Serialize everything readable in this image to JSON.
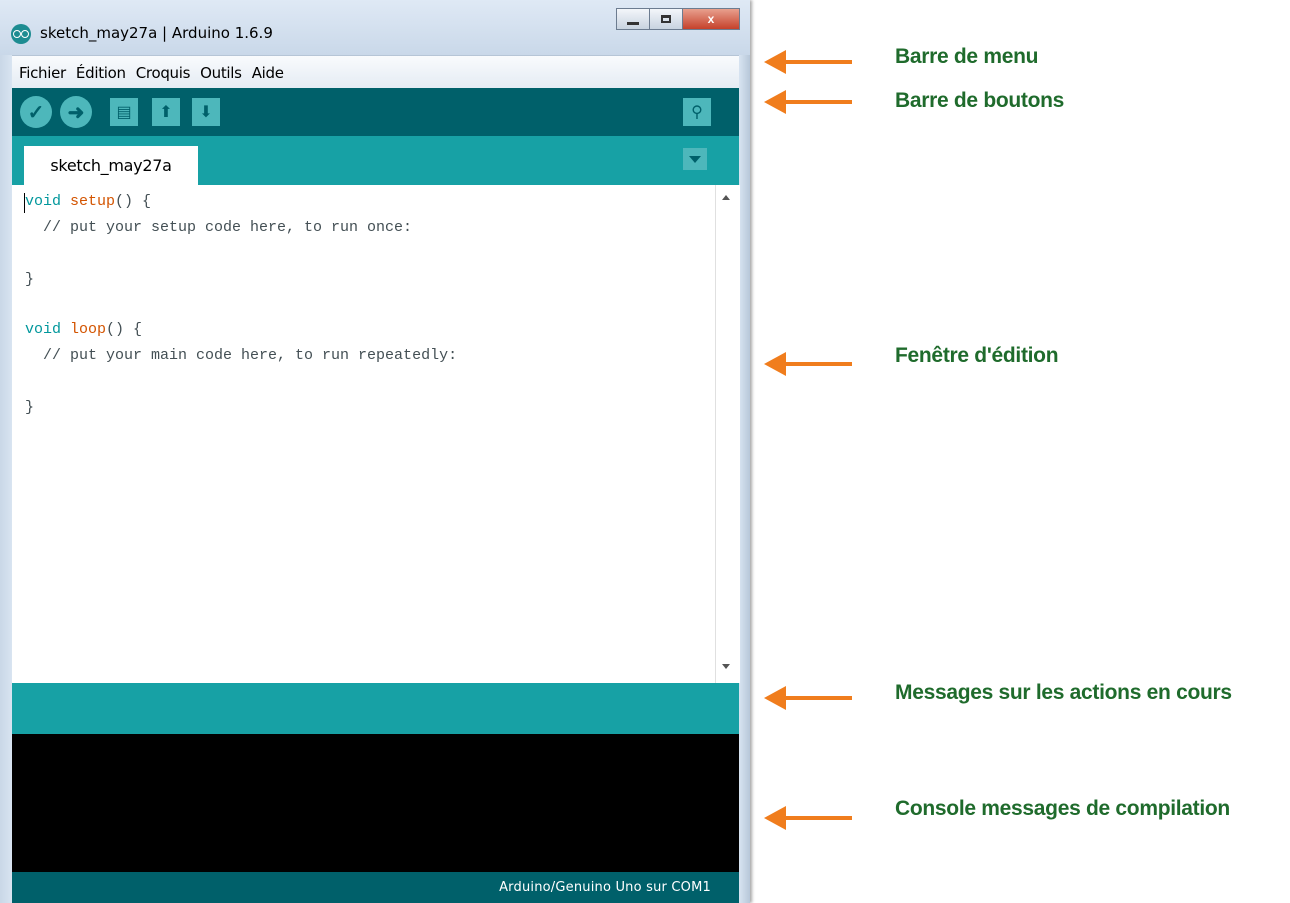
{
  "window": {
    "title": "sketch_may27a | Arduino 1.6.9",
    "close_glyph": "x"
  },
  "menu": {
    "items": [
      "Fichier",
      "Édition",
      "Croquis",
      "Outils",
      "Aide"
    ]
  },
  "toolbar": {
    "verify_glyph": "✓",
    "upload_glyph": "➜",
    "new_glyph": "▤",
    "open_glyph": "⬆",
    "save_glyph": "⬇",
    "serial_monitor_glyph": "⚲"
  },
  "tab": {
    "label": "sketch_may27a"
  },
  "editor": {
    "lines": [
      {
        "kw": "void",
        "fn": "setup",
        "rest": "() {"
      },
      {
        "text": "  // put your setup code here, to run once:"
      },
      {
        "text": ""
      },
      {
        "text": "}"
      },
      {
        "text": ""
      },
      {
        "kw": "void",
        "fn": "loop",
        "rest": "() {"
      },
      {
        "text": "  // put your main code here, to run repeatedly:"
      },
      {
        "text": ""
      },
      {
        "text": "}"
      }
    ]
  },
  "status": {
    "board": "Arduino/Genuino Uno sur COM1"
  },
  "annotations": [
    "Barre de menu",
    "Barre de boutons",
    "Fenêtre d'édition",
    "Messages sur les actions en cours",
    "Console messages de compilation"
  ],
  "colors": {
    "arduino_dark_teal": "#00606a",
    "arduino_teal": "#17a1a5",
    "button_teal": "#4db7bb",
    "arrow_orange": "#f07d1d",
    "label_green": "#1f6b2c"
  },
  "icons": {
    "app": "arduino-logo-icon",
    "verify": "check-icon",
    "upload": "arrow-right-icon",
    "new": "new-file-icon",
    "open": "open-arrow-up-icon",
    "save": "save-arrow-down-icon",
    "serial_monitor": "magnifier-icon",
    "tab_menu": "chevron-down-icon"
  }
}
